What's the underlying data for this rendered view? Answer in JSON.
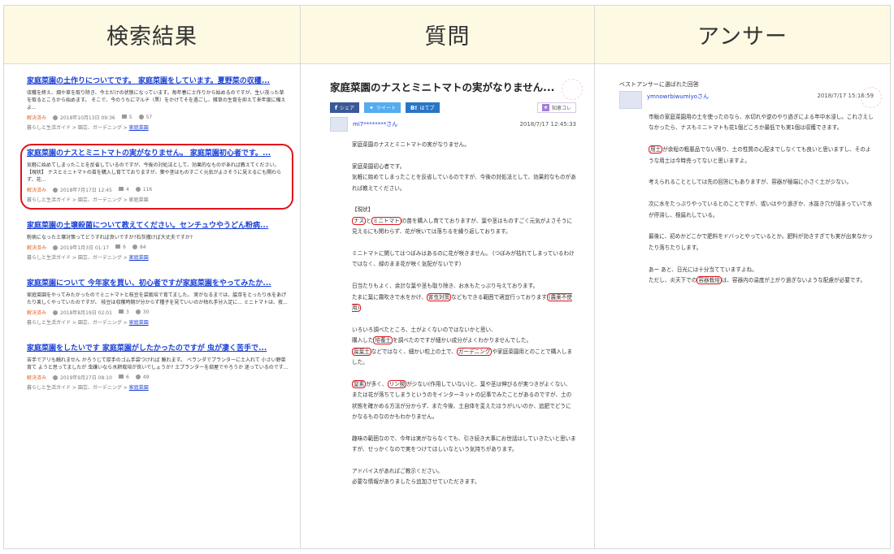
{
  "headers": {
    "results": "検索結果",
    "question": "質問",
    "answer": "アンサー"
  },
  "results": [
    {
      "title": "家庭菜園の土作りについてです。 家庭菜園をしています。夏野菜の収穫...",
      "snippet": "収穫を終え、畑や草を取り除き、今土だけの状態になっています。毎年春に土作りから始めるのですが、生い茂った草を取るところから始めます。 そこで、今のうちにマルチ（黒）をかけてそを過ごし、雑草の生育を抑えて来年度に備えよ...",
      "status": "解決済み",
      "date": "2018年10月13日 09:36",
      "answers": "5",
      "views": "57",
      "category_path": "暮らしと生活ガイド > 園芸、ガーデニング >",
      "category_link": "家庭菜園",
      "highlighted": false
    },
    {
      "title": "家庭菜園のナスとミニトマトの実がなりません。 家庭菜園初心者です。...",
      "snippet": "気軽に始めてしまったことを反省しているのですが、今後の対処法として、効果的なものがあれば教えてください。 【現状】 ナスとミニトマトの苗を購入し育てておりますが、葉や茎はものすごく元気がよさそうに見えるにも関わらず、花...",
      "status": "解決済み",
      "date": "2018年7月17日 12:45",
      "answers": "4",
      "views": "116",
      "category_path": "暮らしと生活ガイド > 園芸、ガーデニング > 家庭菜園",
      "category_link": "",
      "highlighted": true
    },
    {
      "title": "家庭菜園の土壌殺菌について教えてください。センチュウやうどん粉病...",
      "snippet": "粉病になった土壌対策ってどうすれば良いですか?石灰撒けば大丈夫ですか?",
      "status": "解決済み",
      "date": "2019年1月3日 01:17",
      "answers": "6",
      "views": "84",
      "category_path": "暮らしと生活ガイド > 園芸、ガーデニング >",
      "category_link": "家庭菜園",
      "highlighted": false
    },
    {
      "title": "家庭菜園について 今年家を買い、初心者ですが家庭菜園をやってみたか...",
      "snippet": "家庭菜園をやってみたかったのでミニトマトと枝豆を袋栽培で育てました。 実がなるまでは、脇芽をとったり水をあげたり楽しくやっていたのですが、 枝豆は収穫時期が分からず種子を見ていいのか枯れ手分入足に... ミニトマトは、夜...",
      "status": "解決済み",
      "date": "2018年8月19日 02:01",
      "answers": "3",
      "views": "30",
      "category_path": "暮らしと生活ガイド > 園芸、ガーデニング >",
      "category_link": "家庭菜園",
      "highlighted": false
    },
    {
      "title": "家庭菜園をしたいです 家庭菜園がしたかったのですが 虫が凄く苦手で...",
      "snippet": "苦手でアリも触れません かろうじて厚手のゴム手袋つければ 触れます。 ベランダでプランターに土入れて 小さい野菜育て ようと思ってましたが 虫嫌いなら水耕栽培が良いでしょうか? 土プランターを部屋でやろうか 迷っているのです...",
      "status": "解決済み",
      "date": "2019年9月27日 08:10",
      "answers": "6",
      "views": "49",
      "category_path": "暮らしと生活ガイド > 園芸、ガーデニング >",
      "category_link": "家庭菜園",
      "highlighted": false
    }
  ],
  "question": {
    "title": "家庭菜園のナスとミニトマトの実がなりません...",
    "share_facebook": "シェア",
    "share_twitter": "ツイート",
    "share_hatena": "はてブ",
    "chiekore": "知恵コレ",
    "asker": "mi7********さん",
    "date": "2018/7/17  12:45:33",
    "p1": "家庭菜園のナスとミニトマトの実がなりません。",
    "p2a": "家庭菜園初心者です。",
    "p2b": "気軽に始めてしまったことを反省しているのですが、今後の対処法として、効果的なものがあれば教えてください。",
    "p3_label": "【現状】",
    "p3_hl1": "ナス",
    "p3_mid1": "と",
    "p3_hl2": "ミニトマト",
    "p3_rest": "の苗を購入し育てておりますが、葉や茎はものすごく元気がよさそうに見えるにも関わらず、花が咲いては落ちるを繰り返しております。",
    "p4": "ミニトマトに関してはつぼみはあるのに花が咲きません。 (つぼみが枯れてしまっているわけではなく、緑のまま花が咲く気配がないです)",
    "p5a": "日当たりもよく、余計な葉や茎も取り除き、お水もたっぷり与えております。",
    "p5b": "たまに葉に霧吹きで水をかけ、",
    "p5_hl1": "害虫対策",
    "p5c": "などもできる範囲で適宜行っております",
    "p5_hl2": "(農薬不使用)",
    "p6a": "いろいろ調べたところ、土がよくないのではないかと思い、",
    "p6b": "購入した",
    "p6_hl1": "培養土",
    "p6c": "を調べたのですが細かい成分がよくわかりませんでした。",
    "p6_hl2": "腐葉土",
    "p6d": "などではなく、細かい粒上の土で、",
    "p6_hl3": "ガーデニング",
    "p6e": "や家庭菜園用とのことで購入しました。",
    "p7_hl1": "窒素",
    "p7a": "が多く、",
    "p7_hl2": "リン酸",
    "p7b": "が少ない(作用していない)と、葉や茎は伸びるが実つきがよくない、または花が落ちてしまうというのをインターネットの記事でみたことがあるのですが、土の状態を確かめる方法が分からず、また今後、土自体を変えたほうがいいのか、追肥でどうにかなるものなのかもわかりません。",
    "p8": "趣味の範囲なので、今年は実がならなくても、引き続き大事にお世話はしていきたいと思いますが、せっかくなので実をつけてほしいなという気持ちがあります。",
    "p9a": "アドバイスがあればご教示ください。",
    "p9b": "必要な情報がありましたら追加させていただきます。"
  },
  "answer": {
    "label": "ベストアンサーに選ばれた回答",
    "answerer": "ymnowrbiwumiyoさん",
    "date": "2018/7/17  15:16:59",
    "p1": "市販の家庭菜園用の土を使ったのなら、水切れや逆のやり過ぎによる年中水浸し。これさえしなかったら、ナスもミニトマトも花1個どころか最低でも実1個は収穫できます。",
    "p2_hl": "用土",
    "p2_rest": "が余程の粗悪品でない限り、土の性質の心配までしなくても良いと思いますし、そのような用土は今時売ってないと思いますよ。",
    "p3": "考えられることとしては先の回答にもありますが、容器が極端に小さく土が少ない。",
    "p4": "次に水をたっぷりやっているとのことですが、或いはやり過ぎか、水抜き穴が詰まっていて水が停滞し、根腐れしている。",
    "p5": "最後に、初めかどこかで肥料をドバっとやっているとか。肥料が効きすぎても実が出来なかったり落ちたりします。",
    "p6a": "あー あと、日光には十分当てていますよね。",
    "p6b": "ただし、炎天下での",
    "p6_hl": "容器栽培",
    "p6c": "は、容器内の温度が上がり過ぎないような配慮が必要です。"
  }
}
